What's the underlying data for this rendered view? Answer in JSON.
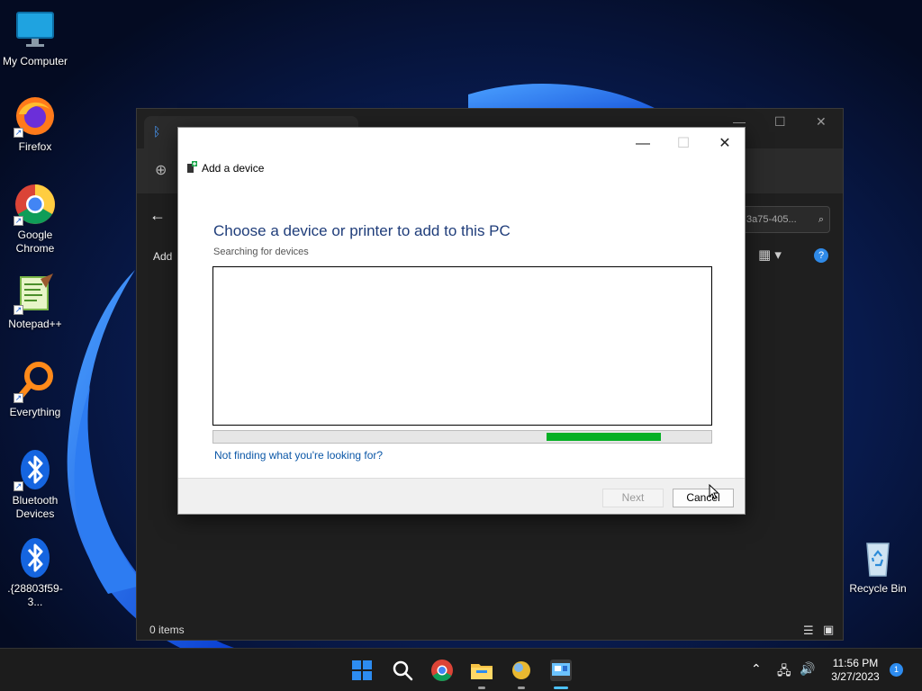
{
  "desktop": {
    "icons": [
      {
        "label": "My Computer",
        "icon": "monitor-icon"
      },
      {
        "label": "Firefox",
        "icon": "firefox-icon"
      },
      {
        "label": "Google Chrome",
        "icon": "chrome-icon"
      },
      {
        "label": "Notepad++",
        "icon": "notepadpp-icon"
      },
      {
        "label": "Everything",
        "icon": "everything-icon"
      },
      {
        "label": "Bluetooth Devices",
        "icon": "bluetooth-icon"
      },
      {
        "label": ".{28803f59-3...",
        "icon": "bluetooth-icon"
      },
      {
        "label": "Recycle Bin",
        "icon": "recycle-bin-icon"
      }
    ]
  },
  "explorer": {
    "search_placeholder": "3a75-405...",
    "command_label": "Add",
    "status": "0 items"
  },
  "dialog": {
    "title": "Add a device",
    "heading": "Choose a device or printer to add to this PC",
    "subtext": "Searching for devices",
    "progress_fraction": 0.23,
    "help_link": "Not finding what you're looking for?",
    "next_label": "Next",
    "cancel_label": "Cancel"
  },
  "taskbar": {
    "time": "11:56 PM",
    "date": "3/27/2023",
    "notification_count": "1"
  },
  "colors": {
    "accent": "#06b025",
    "heading": "#1f3d7a",
    "link": "#0b57a7"
  }
}
